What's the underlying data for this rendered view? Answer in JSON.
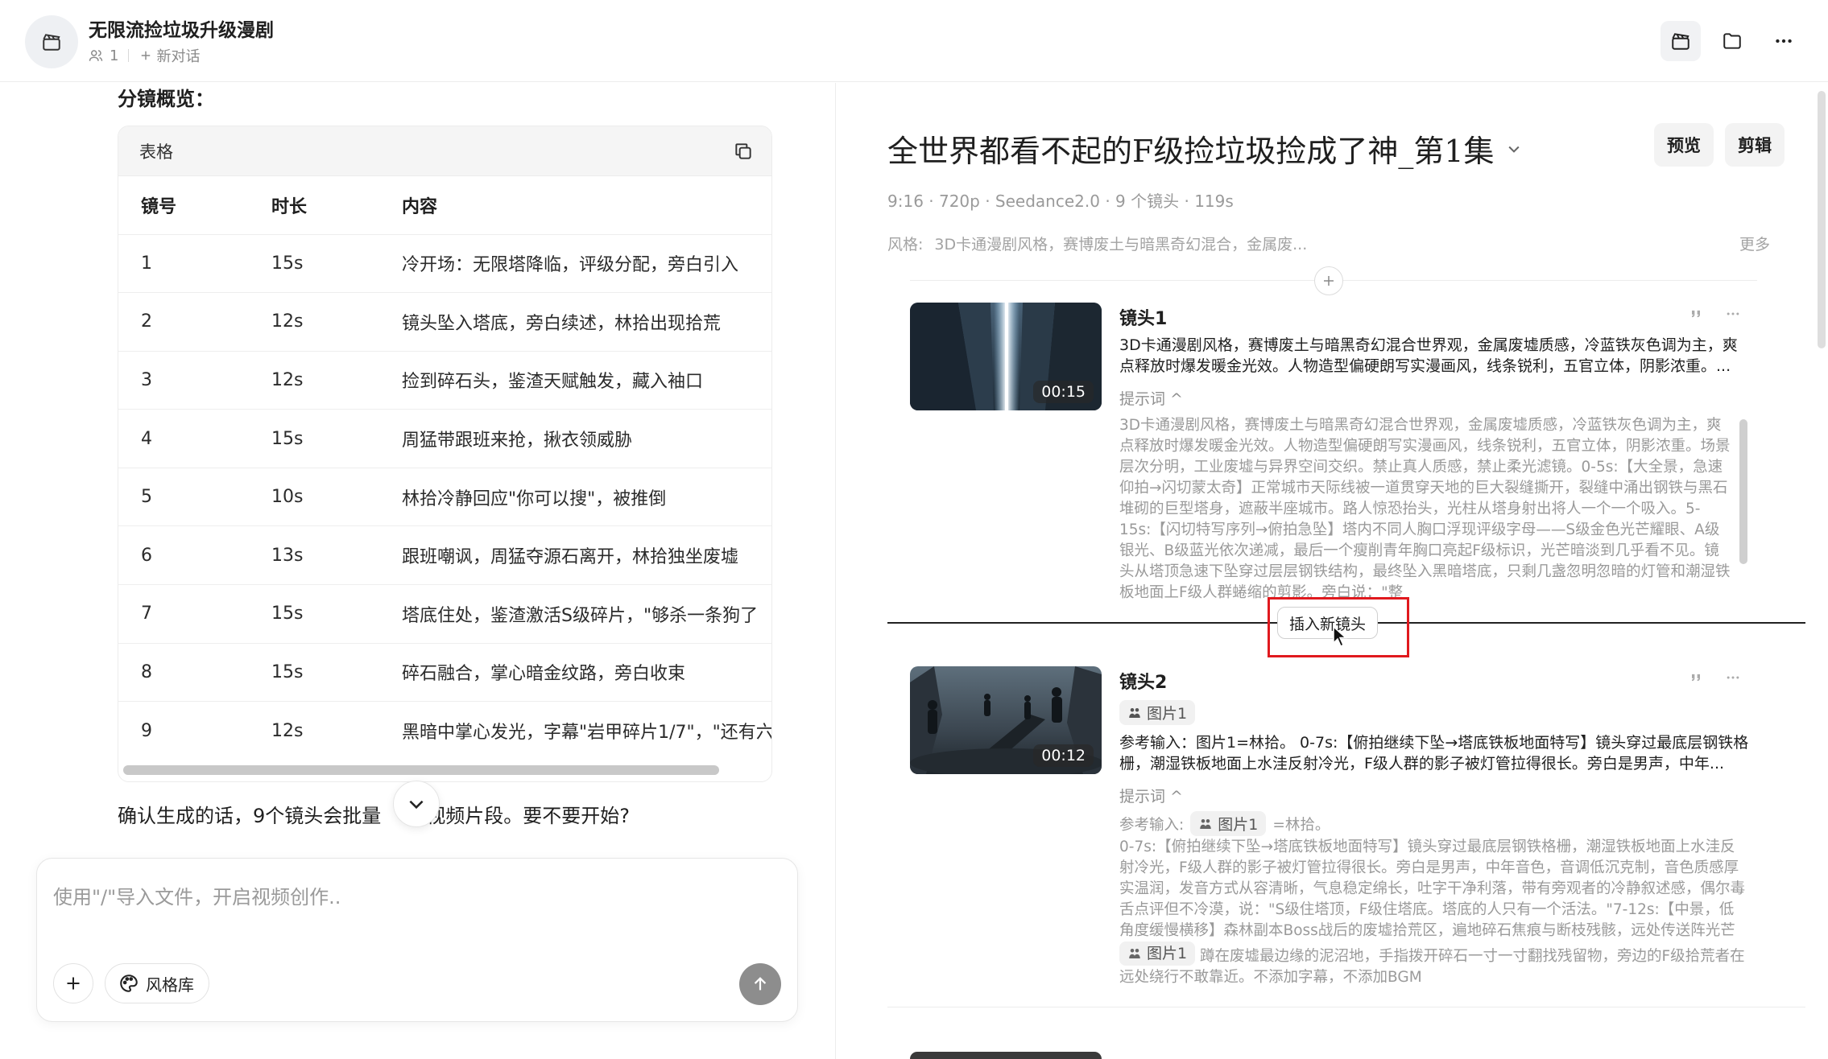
{
  "header": {
    "project_title": "无限流捡垃圾升级漫剧",
    "member_count": "1",
    "new_chat_label": "新对话",
    "icons": [
      "clapperboard-icon",
      "users-icon",
      "plus-icon",
      "clapperboard-icon",
      "folder-icon",
      "more-icon"
    ]
  },
  "left": {
    "section_title": "分镜概览：",
    "table_card_label": "表格",
    "columns": [
      "镜号",
      "时长",
      "内容"
    ],
    "rows": [
      [
        "1",
        "15s",
        "冷开场：无限塔降临，评级分配，旁白引入"
      ],
      [
        "2",
        "12s",
        "镜头坠入塔底，旁白续述，林拾出现拾荒"
      ],
      [
        "3",
        "12s",
        "捡到碎石头，鉴渣天赋触发，藏入袖口"
      ],
      [
        "4",
        "15s",
        "周猛带跟班来抢，揪衣领威胁"
      ],
      [
        "5",
        "10s",
        "林拾冷静回应\"你可以搜\"，被推倒"
      ],
      [
        "6",
        "13s",
        "跟班嘲讽，周猛夺源石离开，林拾独坐废墟"
      ],
      [
        "7",
        "15s",
        "塔底住处，鉴渣激活S级碎片，\"够杀一条狗了"
      ],
      [
        "8",
        "15s",
        "碎石融合，掌心暗金纹路，旁白收束"
      ],
      [
        "9",
        "12s",
        "黑暗中掌心发光，字幕\"岩甲碎片1/7\"，\"还有六"
      ]
    ],
    "confirm_text_a": "确认生成的话，9个镜头会批量",
    "confirm_text_b": "视频片段。要不要开始?",
    "input_placeholder": "使用\"/\"导入文件，开启视频创作..",
    "style_library_label": "风格库"
  },
  "right": {
    "episode_title": "全世界都看不起的F级捡垃圾捡成了神_第1集",
    "preview_label": "预览",
    "edit_label": "剪辑",
    "meta": "9:16 · 720p · Seedance2.0 · 9 个镜头 · 119s",
    "style_key": "风格:",
    "style_value": "3D卡通漫剧风格，赛博废土与暗黑奇幻混合，金属废...",
    "more_label": "更多",
    "insert_shot_label": "插入新镜头",
    "shots": [
      {
        "name": "镜头1",
        "duration": "00:15",
        "description": "3D卡通漫剧风格，赛博废土与暗黑奇幻混合世界观，金属废墟质感，冷蓝铁灰色调为主，爽点释放时爆发暖金光效。人物造型偏硬朗写实漫画风，线条锐利，五官立体，阴影浓重。...",
        "prompt_label": "提示词 ^",
        "prompt": "3D卡通漫剧风格，赛博废土与暗黑奇幻混合世界观，金属废墟质感，冷蓝铁灰色调为主，爽点释放时爆发暖金光效。人物造型偏硬朗写实漫画风，线条锐利，五官立体，阴影浓重。场景层次分明，工业废墟与异界空间交织。禁止真人质感，禁止柔光滤镜。0-5s:【大全景，急速仰拍→闪切蒙太奇】正常城市天际线被一道贯穿天地的巨大裂缝撕开，裂缝中涌出钢铁与黑石堆砌的巨型塔身，遮蔽半座城市。路人惊恐抬头，光柱从塔身射出将人一个一个吸入。5-15s:【闪切特写序列→俯拍急坠】塔内不同人胸口浮现评级字母——S级金色光芒耀眼、A级银光、B级蓝光依次递减，最后一个瘦削青年胸口亮起F级标识，光芒暗淡到几乎看不见。镜头从塔顶急速下坠穿过层层钢铁结构，最终坠入黑暗塔底，只剩几盏忽明忽暗的灯管和潮湿铁板地面上F级人群蜷缩的剪影。旁白说：\"整"
      },
      {
        "name": "镜头2",
        "duration": "00:12",
        "ref_chip": "图片1",
        "description": "参考输入：图片1=林拾。 0-7s:【俯拍继续下坠→塔底铁板地面特写】镜头穿过最底层钢铁格栅，潮湿铁板地面上水洼反射冷光，F级人群的影子被灯管拉得很长。旁白是男声，中年...",
        "prompt_label": "提示词 ^",
        "ref_label": "参考输入:",
        "ref_suffix": "=林拾。",
        "prompt_a": "0-7s:【俯拍继续下坠→塔底铁板地面特写】镜头穿过最底层钢铁格栅，潮湿铁板地面上水洼反射冷光，F级人群的影子被灯管拉得很长。旁白是男声，中年音色，音调低沉克制，音色质感厚实温润，发音方式从容清晰，气息稳定绵长，吐字干净利落，带有旁观者的冷静叙述感，偶尔毒舌点评但不冷漠，说：\"S级住塔顶，F级住塔底。塔底的人只有一个活法。\"7-12s:【中景，低角度缓慢横移】森林副本Boss战后的废墟拾荒区，遍地碎石焦痕与断枝残骸，远处传送阵光芒正在消散。林拾",
        "prompt_b": "蹲在废墟最边缘的泥沼地，手指拨开碎石一寸一寸翻找残留物，旁边的F级拾荒者在远处绕行不敢靠近。不添加字幕，不添加BGM"
      }
    ]
  },
  "colors": {
    "highlight_box": "#e0191e",
    "send_button": "#8d8d8d"
  }
}
